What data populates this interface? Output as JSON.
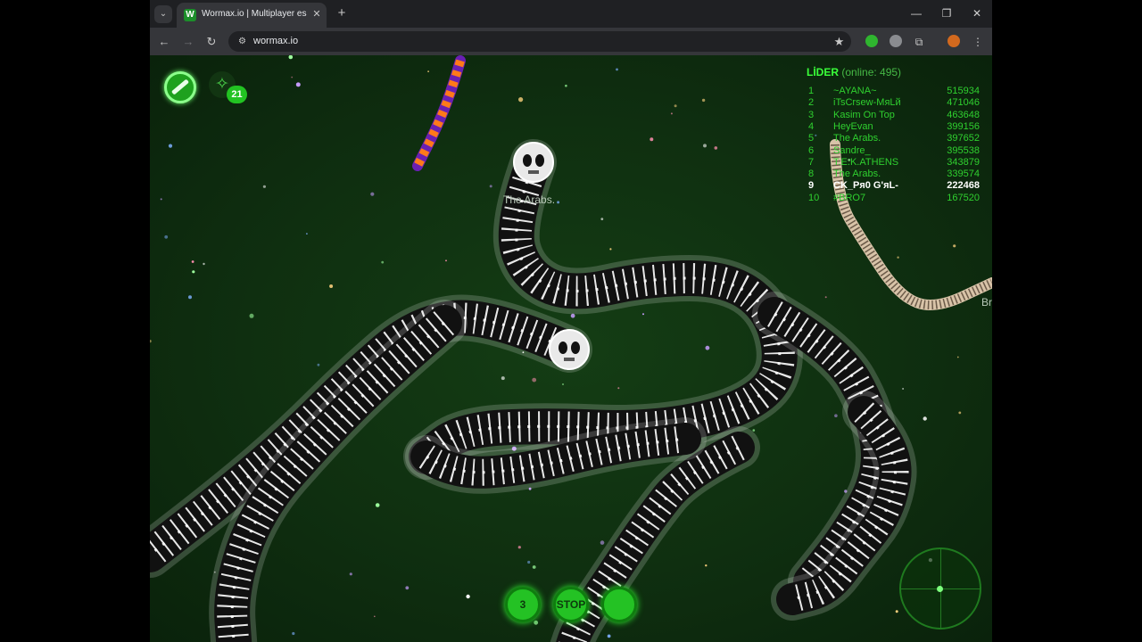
{
  "browser": {
    "tab": {
      "title": "Wormax.io | Multiplayer esaslı b",
      "favicon": "W",
      "close_glyph": "✕"
    },
    "new_tab_glyph": "+",
    "tab_search_glyph": "⌄",
    "window_controls": {
      "minimize": "—",
      "maximize": "❐",
      "close": "✕"
    },
    "nav": {
      "back": "←",
      "forward": "→",
      "reload": "↻"
    },
    "omnibox": {
      "url": "wormax.io",
      "tune_glyph": "⚙",
      "star_glyph": "★"
    },
    "toolbar_icons": {
      "extensions": "⧉",
      "menu": "⋮"
    }
  },
  "hud": {
    "dna_glyph": "✧",
    "dna_count": "21"
  },
  "leaderboard": {
    "title": "LİDER",
    "online": "(online: 495)",
    "rows": [
      {
        "rank": "1",
        "name": "~AYANA~",
        "score": "515934"
      },
      {
        "rank": "2",
        "name": "iTsCrsew-MяLй",
        "score": "471046"
      },
      {
        "rank": "3",
        "name": "Kasim On Top",
        "score": "463648"
      },
      {
        "rank": "4",
        "name": "HeyEvan",
        "score": "399156"
      },
      {
        "rank": "5",
        "name": "The Arabs.",
        "score": "397652"
      },
      {
        "rank": "6",
        "name": "Sandre_",
        "score": "395538"
      },
      {
        "rank": "7",
        "name": "T.E.K.ATHENS",
        "score": "343879"
      },
      {
        "rank": "8",
        "name": "The Arabs.",
        "score": "339574"
      },
      {
        "rank": "9",
        "name": "CK_Pя0 G'яL-",
        "score": "222468"
      },
      {
        "rank": "10",
        "name": "#BRO7",
        "score": "167520"
      }
    ]
  },
  "labels": {
    "worm_name": "The Arabs.",
    "edge_name": "Br"
  },
  "controls": {
    "left_label": "3",
    "stop_label": "STOP"
  },
  "colors": {
    "accent_green": "#3aff3a",
    "background_green": "#0f2f10",
    "worm_body": "#111111",
    "worm_stripe": "#e8e8e8"
  }
}
